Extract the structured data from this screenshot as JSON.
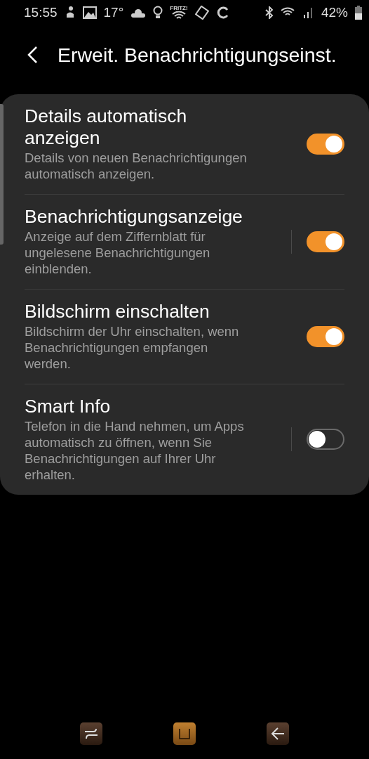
{
  "status_bar": {
    "time": "15:55",
    "temperature": "17°",
    "wifi_label": "FRITZ!",
    "battery": "42%"
  },
  "header": {
    "title": "Erweit. Benachrichtigungseinst."
  },
  "settings": [
    {
      "title": "Details automatisch anzeigen",
      "subtitle": "Details von neuen Benachrichtigungen automatisch anzeigen.",
      "on": true,
      "divider": false
    },
    {
      "title": "Benachrichtigungsanzeige",
      "subtitle": "Anzeige auf dem Ziffernblatt für ungelesene Benachrichtigungen einblenden.",
      "on": true,
      "divider": true
    },
    {
      "title": "Bildschirm einschalten",
      "subtitle": "Bildschirm der Uhr einschalten, wenn Benachrichtigungen empfangen werden.",
      "on": true,
      "divider": false
    },
    {
      "title": "Smart Info",
      "subtitle": "Telefon in die Hand nehmen, um Apps automatisch zu öffnen, wenn Sie Benachrichtigungen auf Ihrer Uhr erhalten.",
      "on": false,
      "divider": true
    }
  ]
}
